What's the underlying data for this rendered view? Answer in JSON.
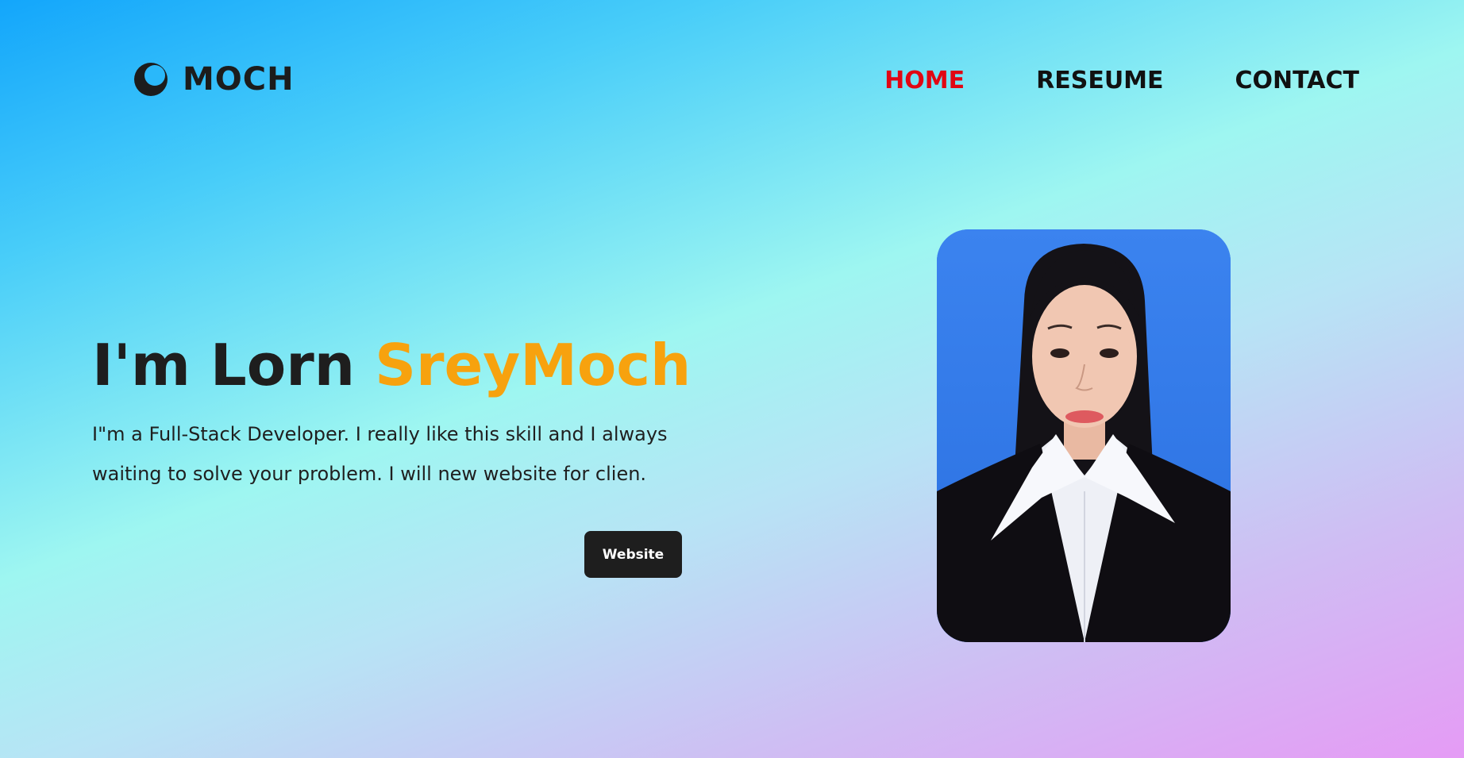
{
  "brand": {
    "name": "MOCH",
    "logo_icon": "crescent-moon-icon"
  },
  "nav": {
    "items": [
      {
        "label": "HOME",
        "active": true
      },
      {
        "label": "RESEUME",
        "active": false
      },
      {
        "label": "CONTACT",
        "active": false
      }
    ]
  },
  "hero": {
    "title_prefix": "I'm Lorn ",
    "title_accent": "SreyMoch",
    "description": "I\"m a Full-Stack Developer. I really like this skill and I always waiting to solve your problem. I will new website for clien.",
    "button_label": "Website"
  },
  "colors": {
    "accent": "#f7a20e",
    "active_nav": "#e10613",
    "dark": "#1e1e1e",
    "photo_background": "#2f7aea"
  }
}
